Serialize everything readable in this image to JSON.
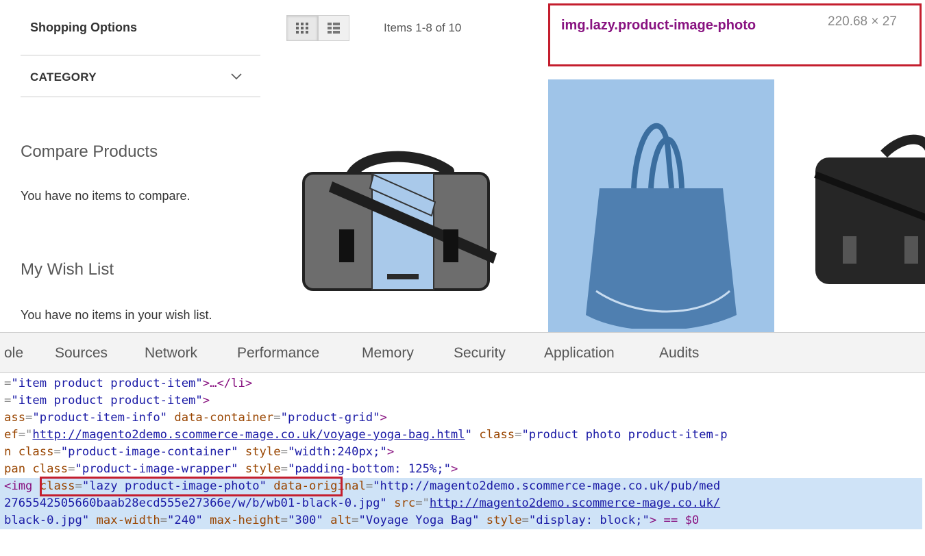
{
  "sidebar": {
    "title": "Shopping Options",
    "category_label": "CATEGORY",
    "compare_title": "Compare Products",
    "compare_text": "You have no items to compare.",
    "wishlist_title": "My Wish List",
    "wishlist_text": "You have no items in your wish list."
  },
  "toolbar": {
    "amount": "Items 1-8 of 10"
  },
  "inspect_tooltip": {
    "element_name": "img.lazy.product-image-photo",
    "size": "220.68 × 27"
  },
  "colors": {
    "highlight": "#9fc4e8",
    "tooltip_border": "#c41e2e",
    "tag": "#881280",
    "attr_name": "#994500",
    "attr_value": "#1a1aa6"
  },
  "devtools": {
    "tabs": [
      "ole",
      "Sources",
      "Network",
      "Performance",
      "Memory",
      "Security",
      "Application",
      "Audits"
    ],
    "lines": [
      {
        "pre": "=",
        "v1": "\"item product product-item\"",
        "rest": ">…</li>"
      },
      {
        "pre": "=",
        "v1": "\"item product product-item\"",
        "rest": ">"
      },
      {
        "a1": "ass",
        "v1": "\"product-item-info\"",
        "a2": "data-container",
        "v2": "\"product-grid\"",
        "rest": ">"
      },
      {
        "a1": "ef",
        "link": "http://magento2demo.scommerce-mage.co.uk/voyage-yoga-bag.html",
        "a2": "class",
        "v2": "\"product photo product-item-p"
      },
      {
        "a1": "n class",
        "v1": "\"product-image-container\"",
        "a2": "style",
        "v2": "\"width:240px;\"",
        "rest": ">"
      },
      {
        "a1": "pan class",
        "v1": "\"product-image-wrapper\"",
        "a2": "style",
        "v2": "\"padding-bottom: 125%;\"",
        "rest": ">"
      },
      {
        "tag": "<img",
        "a1": "class",
        "v1": "\"lazy product-image-photo\"",
        "a2": "data-original",
        "v2": "\"http://magento2demo.scommerce-mage.co.uk/pub/med"
      },
      {
        "v1": "2765542505660baab28ecd555e27366e/w/b/wb01-black-0.jpg\"",
        "a2": "src",
        "link": "http://magento2demo.scommerce-mage.co.uk/"
      },
      {
        "v1": "black-0.jpg\"",
        "a2": "max-width",
        "v2": "\"240\"",
        "a3": "max-height",
        "v3": "\"300\"",
        "a4": "alt",
        "v4": "\"Voyage Yoga Bag\"",
        "a5": "style",
        "v5": "\"display: block;\"",
        "rest": "> == $0"
      }
    ]
  }
}
